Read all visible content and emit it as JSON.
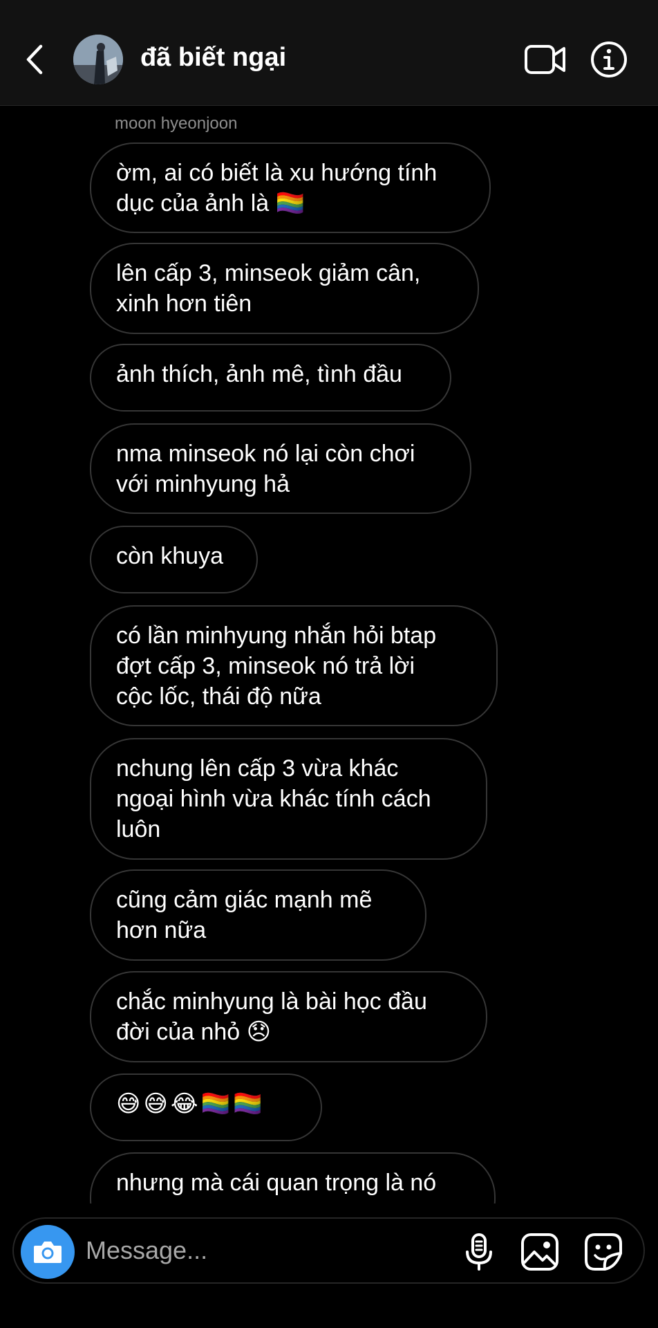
{
  "header": {
    "title": "đã biết ngại",
    "back_icon": "chevron-left-icon",
    "video_icon": "video-camera-icon",
    "info_icon": "info-icon"
  },
  "thread": {
    "sender": "moon hyeonjoon",
    "messages": [
      "ờm, ai có biết là xu hướng tính\ndục của ảnh là 🏳️‍🌈",
      "lên cấp 3, minseok giảm cân,\nxinh hơn tiên",
      "ảnh thích, ảnh mê, tình đầu",
      "nma minseok nó lại còn chơi\nvới minhyung hả",
      "còn khuya",
      "có lần minhyung nhắn hỏi btap\nđợt cấp 3, minseok nó trả lời\ncộc lốc, thái độ nữa",
      "nchung lên cấp 3 vừa khác\nngoại hình vừa khác tính cách\nluôn",
      "cũng cảm giác mạnh mẽ\nhơn nữa",
      "chắc minhyung là bài học đầu\nđời của nhỏ 😞",
      "😅😅😂🏳️‍🌈🏳️‍🌈",
      "nhưng mà cái quan trọng là nó"
    ]
  },
  "composer": {
    "placeholder": "Message...",
    "camera_icon": "camera-icon",
    "mic_icon": "microphone-icon",
    "gallery_icon": "image-icon",
    "sticker_icon": "sticker-icon"
  },
  "colors": {
    "background": "#000000",
    "header_background": "#121212",
    "bubble_border": "#363636",
    "sender_text": "#8e8e8e",
    "camera_button": "#3797f0",
    "placeholder_text": "#a8a8a8"
  }
}
